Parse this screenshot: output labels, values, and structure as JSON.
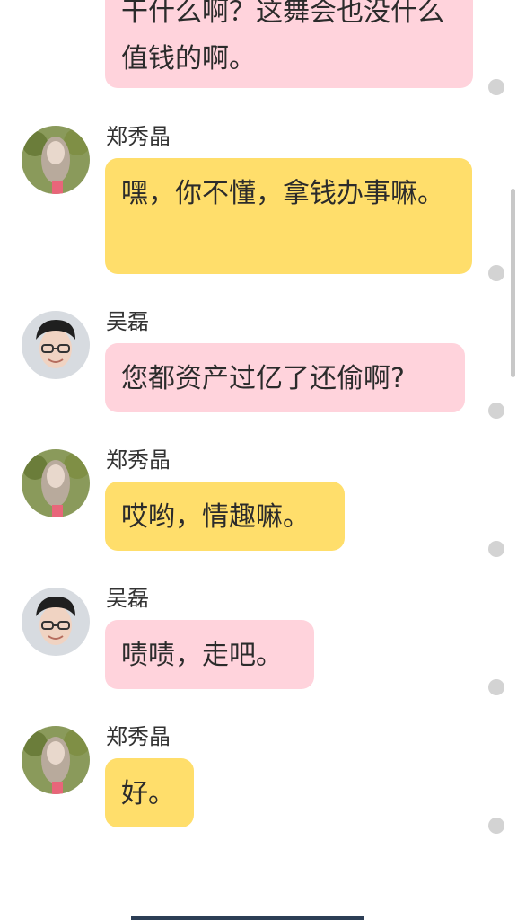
{
  "messages": [
    {
      "sender": "",
      "text": "干什么啊？这舞会也没什么值钱的啊。",
      "bubble_color": "#ffd3dc",
      "avatar": "none"
    },
    {
      "sender": "郑秀晶",
      "text": "嘿，你不懂，拿钱办事嘛。",
      "bubble_color": "#ffde6b",
      "avatar": "girl-avatar"
    },
    {
      "sender": "吴磊",
      "text": "您都资产过亿了还偷啊?",
      "bubble_color": "#ffd3dc",
      "avatar": "boy-avatar"
    },
    {
      "sender": "郑秀晶",
      "text": "哎哟，情趣嘛。",
      "bubble_color": "#ffde6b",
      "avatar": "girl-avatar"
    },
    {
      "sender": "吴磊",
      "text": "啧啧，走吧。",
      "bubble_color": "#ffd3dc",
      "avatar": "boy-avatar"
    },
    {
      "sender": "郑秀晶",
      "text": "好。",
      "bubble_color": "#ffde6b",
      "avatar": "girl-avatar"
    }
  ],
  "colors": {
    "pink_bubble": "#ffd3dc",
    "yellow_bubble": "#ffde6b",
    "status_dot": "#d3d3d3"
  }
}
